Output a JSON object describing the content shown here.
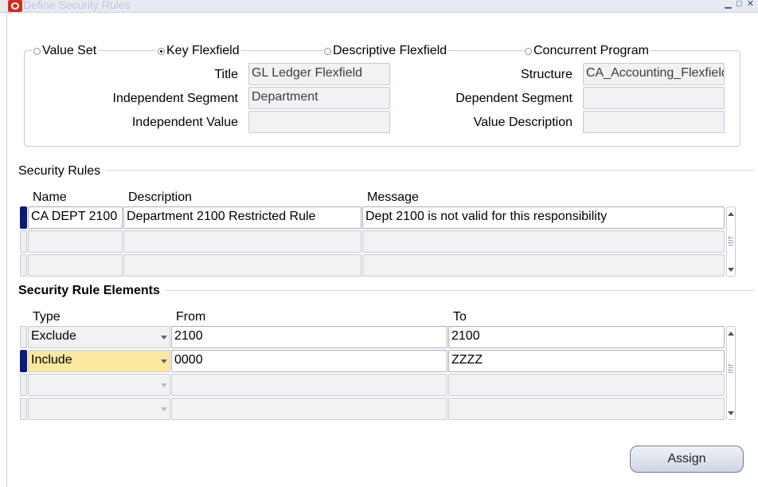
{
  "window": {
    "title": "Define Security Rules",
    "minimize_glyph": "▁",
    "maximize_glyph": "□",
    "close_glyph": "✕"
  },
  "flexfield": {
    "options": [
      "Value Set",
      "Key Flexfield",
      "Descriptive Flexfield",
      "Concurrent Program"
    ],
    "selected": "Key Flexfield",
    "title_label": "Title",
    "title_value": "GL Ledger Flexfield",
    "structure_label": "Structure",
    "structure_value": "CA_Accounting_Flexfield",
    "independent_segment_label": "Independent Segment",
    "independent_segment_value": "Department",
    "dependent_segment_label": "Dependent Segment",
    "dependent_segment_value": "",
    "independent_value_label": "Independent Value",
    "independent_value_value": "",
    "value_description_label": "Value Description",
    "value_description_value": ""
  },
  "security_rules": {
    "section_title": "Security Rules",
    "columns": [
      "Name",
      "Description",
      "Message"
    ],
    "rows": [
      {
        "name": "CA DEPT 2100",
        "description": "Department 2100 Restricted Rule",
        "message": "Dept 2100 is not valid for this responsibility"
      },
      {
        "name": "",
        "description": "",
        "message": ""
      },
      {
        "name": "",
        "description": "",
        "message": ""
      }
    ]
  },
  "elements": {
    "section_title": "Security Rule Elements",
    "columns": [
      "Type",
      "From",
      "To"
    ],
    "rows": [
      {
        "type": "Exclude",
        "from": "2100",
        "to": "2100"
      },
      {
        "type": "Include",
        "from": "0000",
        "to": "ZZZZ"
      },
      {
        "type": "",
        "from": "",
        "to": ""
      },
      {
        "type": "",
        "from": "",
        "to": ""
      }
    ]
  },
  "buttons": {
    "assign": "Assign"
  },
  "colors": {
    "row_indicator": "#0b1a78",
    "selected_cell": "#fde8a0",
    "logo": "#d22d1e"
  },
  "icons": [
    "oracle-logo-icon",
    "minimize-icon",
    "maximize-icon",
    "close-icon",
    "scroll-up-icon",
    "scroll-down-icon",
    "dropdown-arrow-icon"
  ]
}
